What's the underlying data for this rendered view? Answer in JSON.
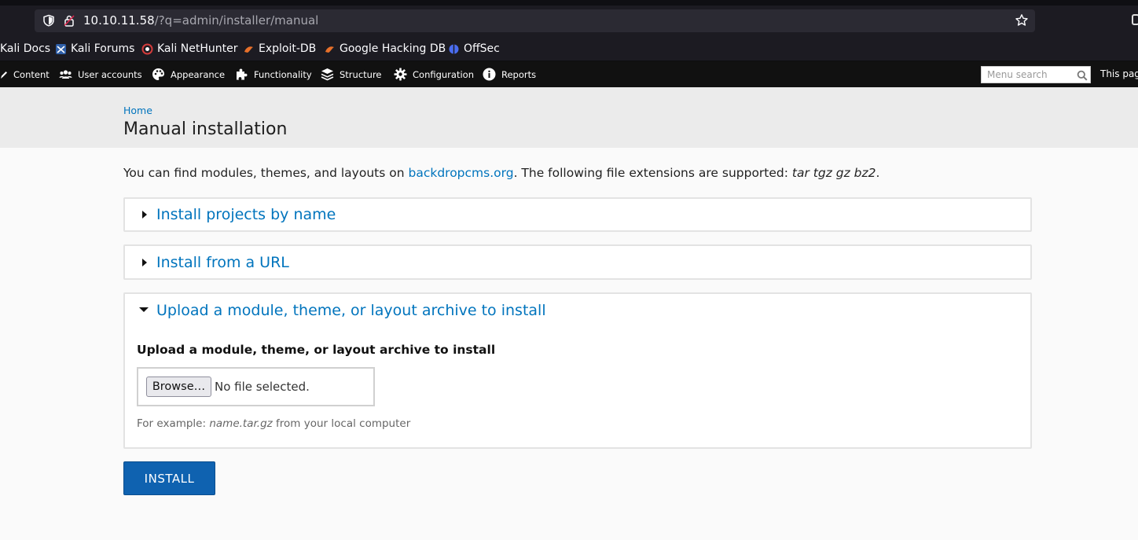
{
  "browser": {
    "url_host": "10.10.11.58",
    "url_path": "/?q=admin/installer/manual"
  },
  "bookmarks": [
    {
      "label": "Kali Docs",
      "icon": "kali-docs-icon",
      "color": "#1c1b22"
    },
    {
      "label": "Kali Forums",
      "icon": "kali-forums-icon",
      "color": "#3a7bd5"
    },
    {
      "label": "Kali NetHunter",
      "icon": "nethunter-icon",
      "color": "#d23b3b"
    },
    {
      "label": "Exploit-DB",
      "icon": "exploitdb-icon",
      "color": "#e8702a"
    },
    {
      "label": "Google Hacking DB",
      "icon": "ghdb-icon",
      "color": "#e8702a"
    },
    {
      "label": "OffSec",
      "icon": "offsec-icon",
      "color": "#4a6cf0"
    }
  ],
  "admin_menu": {
    "items": [
      {
        "label": "Content",
        "icon": "pencil-icon"
      },
      {
        "label": "User accounts",
        "icon": "users-icon"
      },
      {
        "label": "Appearance",
        "icon": "palette-icon"
      },
      {
        "label": "Functionality",
        "icon": "puzzle-icon"
      },
      {
        "label": "Structure",
        "icon": "layers-icon"
      },
      {
        "label": "Configuration",
        "icon": "gear-icon"
      },
      {
        "label": "Reports",
        "icon": "info-icon"
      }
    ],
    "search_placeholder": "Menu search",
    "this_page": "This pag"
  },
  "page": {
    "breadcrumb": "Home",
    "title": "Manual installation",
    "intro_before": "You can find modules, themes, and layouts on ",
    "intro_link": "backdropcms.org",
    "intro_after": ". The following file extensions are supported: ",
    "intro_ext": "tar tgz gz bz2",
    "intro_end": "."
  },
  "fieldsets": {
    "by_name": "Install projects by name",
    "from_url": "Install from a URL",
    "upload": "Upload a module, theme, or layout archive to install"
  },
  "upload": {
    "label": "Upload a module, theme, or layout archive to install",
    "browse_label": "Browse…",
    "no_file": "No file selected.",
    "desc_before": "For example: ",
    "desc_example": "name.tar.gz",
    "desc_after": " from your local computer"
  },
  "install_button": "INSTALL",
  "colors": {
    "link": "#0074bd",
    "button": "#0f62b0"
  }
}
